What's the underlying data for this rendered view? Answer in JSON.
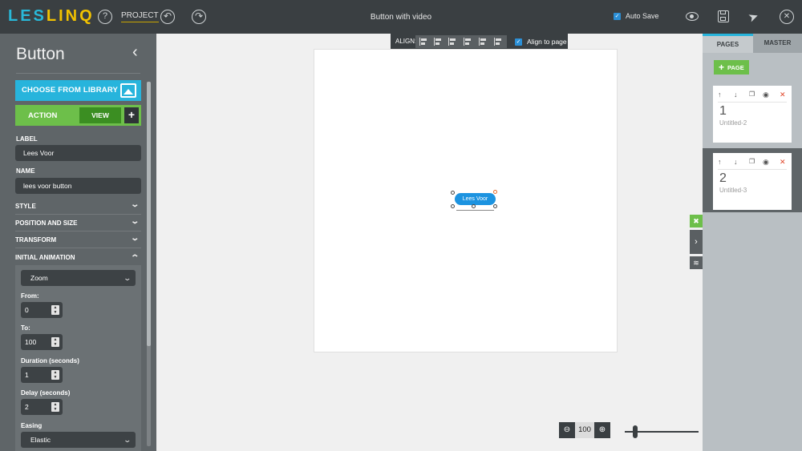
{
  "topbar": {
    "logo_part1": "LES",
    "logo_part2": "LINQ",
    "help_icon": "question-circle-icon",
    "project_label": "PROJECT",
    "undo_icon": "undo-icon",
    "redo_icon": "redo-icon",
    "document_title": "Button with video",
    "autosave_label": "Auto Save",
    "autosave_checked": true
  },
  "left_panel": {
    "title": "Button",
    "choose_library_label": "CHOOSE FROM LIBRARY",
    "action_label": "ACTION",
    "view_label": "VIEW",
    "add_label": "+",
    "label_heading": "LABEL",
    "label_value": "Lees Voor",
    "name_heading": "NAME",
    "name_value": "lees voor button",
    "sections": {
      "style": "STYLE",
      "position_size": "POSITION AND SIZE",
      "transform": "TRANSFORM",
      "initial_animation": "INITIAL ANIMATION"
    },
    "animation": {
      "type_value": "Zoom",
      "from_label": "From:",
      "from_value": "0",
      "to_label": "To:",
      "to_value": "100",
      "duration_label": "Duration (seconds)",
      "duration_value": "1",
      "delay_label": "Delay (seconds)",
      "delay_value": "2",
      "easing_label": "Easing",
      "easing_value": "Elastic"
    }
  },
  "align_bar": {
    "label": "ALIGN:",
    "align_to_page_label": "Align to page",
    "align_to_page_checked": true
  },
  "canvas": {
    "selected_button_label": "Lees Voor"
  },
  "zoom": {
    "value": "100",
    "zoom_out_icon": "zoom-out-icon",
    "zoom_in_icon": "zoom-in-icon"
  },
  "right_panel": {
    "tab_pages": "PAGES",
    "tab_master": "MASTER",
    "add_page_label": "PAGE",
    "pages": [
      {
        "number": "1",
        "name": "Untitled-2"
      },
      {
        "number": "2",
        "name": "Untitled-3"
      }
    ]
  },
  "colors": {
    "accent_blue": "#27b4dc",
    "accent_green": "#6dbf4a",
    "logo_yellow": "#f2c200",
    "dark_bar": "#3a3f42",
    "selected_button": "#1c93e0"
  }
}
